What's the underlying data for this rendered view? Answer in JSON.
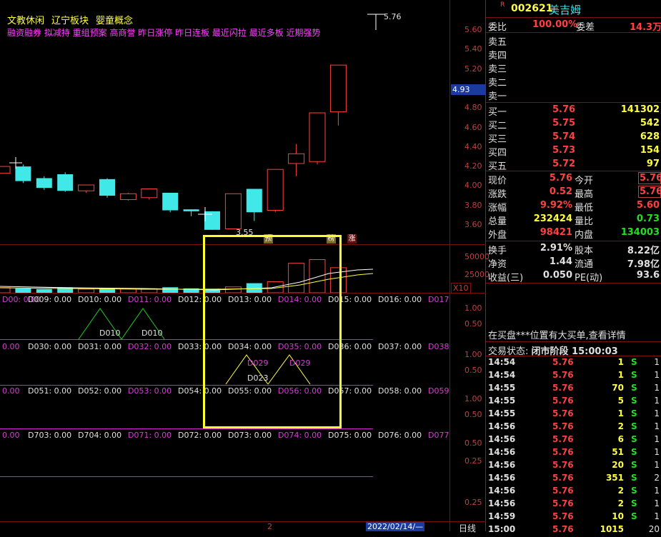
{
  "header": {
    "concepts": [
      "文教休闲",
      "辽宁板块",
      "婴童概念"
    ],
    "tags_line": "融资融券 拟减持 重组预案 高商誉 昨日涨停 昨日连板 最近闪拉 最近多板 近期强势",
    "high_price_label": "5.76",
    "low_price_label": "3.55",
    "current_price_marker": "4.93"
  },
  "price_axis": [
    "5.60",
    "5.40",
    "5.20",
    "5.00",
    "4.80",
    "4.60",
    "4.40",
    "4.20",
    "4.00",
    "3.80",
    "3.60"
  ],
  "volume_axis": [
    "50000",
    "25000"
  ],
  "volume_unit": "X10",
  "chart_markers": {
    "yu": "预",
    "bang": "榜",
    "zhang": "涨"
  },
  "indicator_rows": [
    {
      "labels": [
        "D00: 0.00",
        "D009: 0.00",
        "D010: 0.00",
        "D011: 0.00",
        "D012: 0.00",
        "D013: 0.00",
        "D014: 0.00",
        "D015: 0.00",
        "D016: 0.00",
        "D017"
      ],
      "axis": [
        "1.00",
        "0.50"
      ],
      "annotations": [
        "D010",
        "D010"
      ]
    },
    {
      "labels": [
        "0.00",
        "D030: 0.00",
        "D031: 0.00",
        "D032: 0.00",
        "D033: 0.00",
        "D034: 0.00",
        "D035: 0.00",
        "D036: 0.00",
        "D037: 0.00",
        "D038"
      ],
      "axis": [
        "1.00",
        "0.50"
      ],
      "annotations": [
        "D029",
        "D029",
        "D023"
      ]
    },
    {
      "labels": [
        "0.00",
        "D051: 0.00",
        "D052: 0.00",
        "D053: 0.00",
        "D054: 0.00",
        "D055: 0.00",
        "D056: 0.00",
        "D057: 0.00",
        "D058: 0.00",
        "D059"
      ],
      "axis": [
        "1.00",
        "0.50"
      ]
    },
    {
      "labels": [
        "0.00",
        "D703: 0.00",
        "D704: 0.00",
        "D071: 0.00",
        "D072: 0.00",
        "D073: 0.00",
        "D074: 0.00",
        "D075: 0.00",
        "D076: 0.00",
        "D077"
      ],
      "axis": [
        "0.50",
        "0.25"
      ]
    },
    {
      "labels": [],
      "axis": [
        "0.25"
      ]
    }
  ],
  "bottom_bar": {
    "cursor_mark": "2",
    "date": "2022/02/14/—",
    "period": "日线"
  },
  "stock": {
    "flag": "R",
    "code": "002621",
    "name": "美吉姆"
  },
  "order_ratio": {
    "weibi_label": "委比",
    "weibi_value": "100.00%",
    "weicha_label": "委差",
    "weicha_value": "14.3万"
  },
  "asks": [
    {
      "label": "卖五",
      "price": "",
      "vol": ""
    },
    {
      "label": "卖四",
      "price": "",
      "vol": ""
    },
    {
      "label": "卖三",
      "price": "",
      "vol": ""
    },
    {
      "label": "卖二",
      "price": "",
      "vol": ""
    },
    {
      "label": "卖一",
      "price": "",
      "vol": ""
    }
  ],
  "bids": [
    {
      "label": "买一",
      "price": "5.76",
      "vol": "141302"
    },
    {
      "label": "买二",
      "price": "5.75",
      "vol": "542"
    },
    {
      "label": "买三",
      "price": "5.74",
      "vol": "628"
    },
    {
      "label": "买四",
      "price": "5.73",
      "vol": "154"
    },
    {
      "label": "买五",
      "price": "5.72",
      "vol": "97"
    }
  ],
  "quote": [
    {
      "l1": "现价",
      "v1": "5.76",
      "l2": "今开",
      "v2": "5.76",
      "c1": "red",
      "c2": "red",
      "box2": true
    },
    {
      "l1": "涨跌",
      "v1": "0.52",
      "l2": "最高",
      "v2": "5.76",
      "c1": "red",
      "c2": "red",
      "box2": true
    },
    {
      "l1": "涨幅",
      "v1": "9.92%",
      "l2": "最低",
      "v2": "5.60",
      "c1": "red",
      "c2": "red",
      "box2": false
    },
    {
      "l1": "总量",
      "v1": "232424",
      "l2": "量比",
      "v2": "0.73",
      "c1": "yellow",
      "c2": "green",
      "box2": false
    },
    {
      "l1": "外盘",
      "v1": "98421",
      "l2": "内盘",
      "v2": "134003",
      "c1": "red",
      "c2": "green",
      "box2": false
    }
  ],
  "fundamentals": [
    {
      "l1": "换手",
      "v1": "2.91%",
      "l2": "股本",
      "v2": "8.22亿"
    },
    {
      "l1": "净资",
      "v1": "1.44",
      "l2": "流通",
      "v2": "7.98亿"
    },
    {
      "l1": "收益(三)",
      "v1": "0.050",
      "l2": "PE(动)",
      "v2": "93.6"
    }
  ],
  "notice": "在买盘***位置有大买单,查看详情",
  "trade_status": {
    "label": "交易状态:",
    "value": "闭市阶段 15:00:03"
  },
  "ticks": [
    {
      "time": "14:54",
      "price": "5.76",
      "vol": "1",
      "bs": "S",
      "n": "1"
    },
    {
      "time": "14:54",
      "price": "5.76",
      "vol": "1",
      "bs": "S",
      "n": "1"
    },
    {
      "time": "14:55",
      "price": "5.76",
      "vol": "70",
      "bs": "S",
      "n": "1"
    },
    {
      "time": "14:55",
      "price": "5.76",
      "vol": "5",
      "bs": "S",
      "n": "1"
    },
    {
      "time": "14:55",
      "price": "5.76",
      "vol": "1",
      "bs": "S",
      "n": "1"
    },
    {
      "time": "14:56",
      "price": "5.76",
      "vol": "2",
      "bs": "S",
      "n": "1"
    },
    {
      "time": "14:56",
      "price": "5.76",
      "vol": "6",
      "bs": "S",
      "n": "1"
    },
    {
      "time": "14:56",
      "price": "5.76",
      "vol": "51",
      "bs": "S",
      "n": "1"
    },
    {
      "time": "14:56",
      "price": "5.76",
      "vol": "20",
      "bs": "S",
      "n": "1"
    },
    {
      "time": "14:56",
      "price": "5.76",
      "vol": "351",
      "bs": "S",
      "n": "2"
    },
    {
      "time": "14:56",
      "price": "5.76",
      "vol": "2",
      "bs": "S",
      "n": "1"
    },
    {
      "time": "14:56",
      "price": "5.76",
      "vol": "2",
      "bs": "S",
      "n": "1"
    },
    {
      "time": "14:59",
      "price": "5.76",
      "vol": "10",
      "bs": "S",
      "n": "1"
    },
    {
      "time": "15:00",
      "price": "5.76",
      "vol": "1015",
      "bs": "",
      "n": "20"
    }
  ],
  "candles": [
    {
      "o": 4.13,
      "c": 4.2,
      "h": 4.2,
      "l": 4.13
    },
    {
      "o": 4.2,
      "c": 4.05,
      "h": 4.22,
      "l": 4.03
    },
    {
      "o": 4.08,
      "c": 3.98,
      "h": 4.1,
      "l": 3.96
    },
    {
      "o": 4.12,
      "c": 3.95,
      "h": 4.14,
      "l": 3.94
    },
    {
      "o": 3.95,
      "c": 4.01,
      "h": 4.01,
      "l": 3.93
    },
    {
      "o": 4.07,
      "c": 3.9,
      "h": 4.08,
      "l": 3.88
    },
    {
      "o": 3.86,
      "c": 3.92,
      "h": 3.93,
      "l": 3.85
    },
    {
      "o": 3.88,
      "c": 3.97,
      "h": 3.97,
      "l": 3.86
    },
    {
      "o": 3.93,
      "c": 3.75,
      "h": 3.93,
      "l": 3.73
    },
    {
      "o": 3.76,
      "c": 3.74,
      "h": 3.76,
      "l": 3.69
    },
    {
      "o": 3.74,
      "c": 3.55,
      "h": 3.74,
      "l": 3.55
    },
    {
      "o": 3.56,
      "c": 3.92,
      "h": 3.92,
      "l": 3.56
    },
    {
      "o": 3.97,
      "c": 3.73,
      "h": 3.97,
      "l": 3.64
    },
    {
      "o": 3.75,
      "c": 4.17,
      "h": 4.17,
      "l": 3.73
    },
    {
      "o": 4.23,
      "c": 4.33,
      "h": 4.43,
      "l": 4.1
    },
    {
      "o": 4.25,
      "c": 4.75,
      "h": 4.75,
      "l": 4.22
    },
    {
      "o": 4.76,
      "c": 5.24,
      "h": 5.24,
      "l": 4.62
    }
  ],
  "volumes": [
    7000,
    6000,
    5000,
    7500,
    5000,
    6500,
    5500,
    5500,
    7500,
    6000,
    5500,
    8000,
    13000,
    15000,
    40000,
    45000,
    34000
  ]
}
